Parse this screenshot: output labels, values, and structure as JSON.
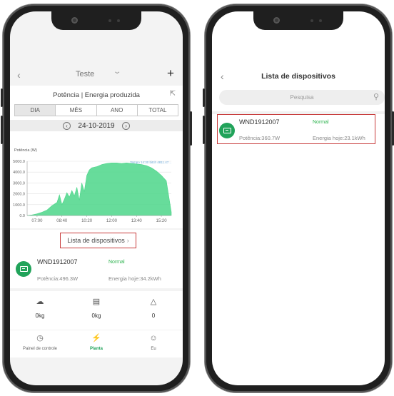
{
  "left": {
    "header": {
      "title": "Teste"
    },
    "section_title": "Potência | Energia produzida",
    "tabs": [
      {
        "label": "DIA",
        "active": true
      },
      {
        "label": "MÊS",
        "active": false
      },
      {
        "label": "ANO",
        "active": false
      },
      {
        "label": "TOTAL",
        "active": false
      }
    ],
    "date": "24-10-2019",
    "chart_data": {
      "type": "area",
      "ylabel": "Potência (W)",
      "ylim": [
        0,
        5000
      ],
      "yticks": [
        "5000.0",
        "4000.0",
        "3000.0",
        "2000.0",
        "1000.0",
        "0.0"
      ],
      "xticks": [
        "07:00",
        "08:40",
        "10:20",
        "12:00",
        "13:40",
        "15:20"
      ],
      "tooltip": "Tempo 14:30 bitch 4811.47...",
      "color": "#4cd68a",
      "x": [
        "06:20",
        "06:40",
        "07:00",
        "07:20",
        "07:40",
        "08:00",
        "08:20",
        "08:30",
        "08:40",
        "08:50",
        "09:00",
        "09:10",
        "09:20",
        "09:30",
        "09:40",
        "09:50",
        "10:00",
        "10:10",
        "10:20",
        "10:30",
        "10:40",
        "11:00",
        "11:20",
        "11:40",
        "12:00",
        "12:20",
        "12:40",
        "13:00",
        "13:20",
        "13:40",
        "14:00",
        "14:20",
        "14:40",
        "15:00",
        "15:20",
        "15:40",
        "16:00"
      ],
      "values": [
        0,
        50,
        150,
        300,
        500,
        900,
        1200,
        1900,
        1000,
        1500,
        2100,
        1700,
        2300,
        1800,
        2600,
        1400,
        3000,
        2200,
        3700,
        4200,
        4400,
        4500,
        4700,
        4800,
        4850,
        4850,
        4800,
        4850,
        4800,
        4750,
        4700,
        4600,
        4400,
        4100,
        3700,
        3200,
        300
      ]
    },
    "list_link": "Lista de dispositivos",
    "device": {
      "name": "WND1912007",
      "status": "Normal",
      "power": "Potência:496.3W",
      "energy": "Energia hoje:34.2kWh"
    },
    "stats": [
      {
        "icon": "co2-cloud-icon",
        "value": "0kg"
      },
      {
        "icon": "coal-cart-icon",
        "value": "0kg"
      },
      {
        "icon": "tree-icon",
        "value": "0"
      }
    ],
    "nav": [
      {
        "icon": "dashboard-gauge-icon",
        "label": "Painel de controle",
        "active": false
      },
      {
        "icon": "plant-icon",
        "label": "Planta",
        "active": true
      },
      {
        "icon": "user-icon",
        "label": "Eu",
        "active": false
      }
    ]
  },
  "right": {
    "title": "Lista de dispositivos",
    "search_placeholder": "Pesquisa",
    "device": {
      "name": "WND1912007",
      "status": "Normal",
      "power": "Potência:360.7W",
      "energy": "Energia hoje:23.1kWh"
    }
  }
}
